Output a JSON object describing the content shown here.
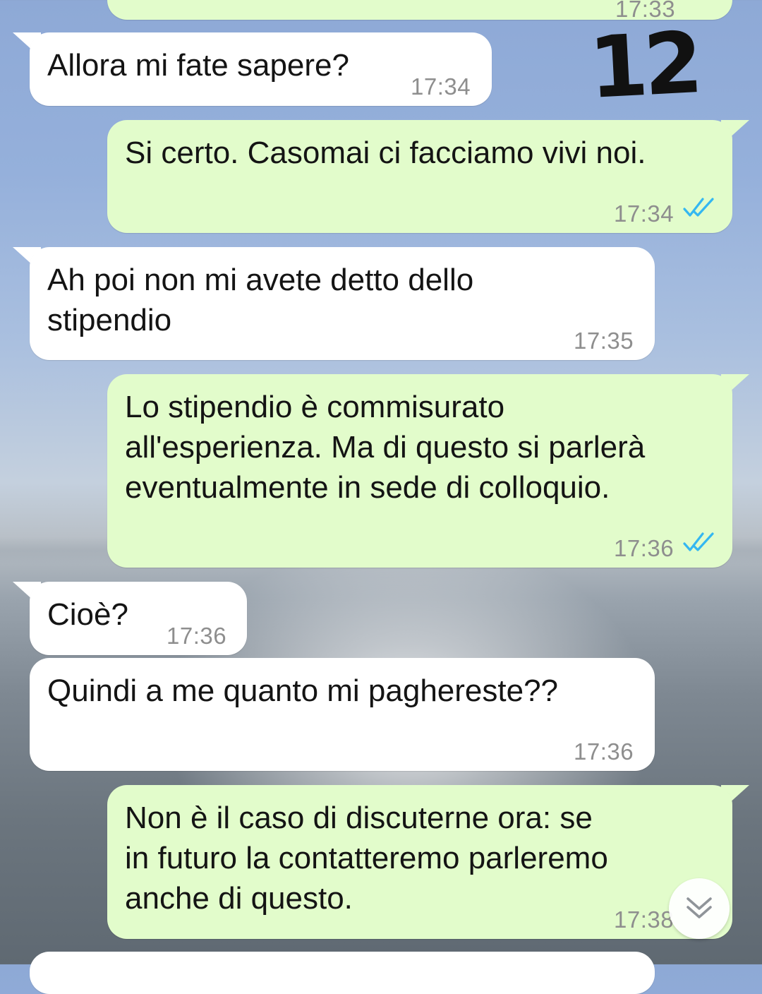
{
  "annotation": {
    "number": "12"
  },
  "messages": [
    {
      "id": "m0",
      "direction": "outgoing",
      "text": "",
      "time": "17:33",
      "read": true
    },
    {
      "id": "m1",
      "direction": "incoming",
      "text": "Allora mi fate sapere?",
      "time": "17:34"
    },
    {
      "id": "m2",
      "direction": "outgoing",
      "text": "Si certo. Casomai ci facciamo vivi noi.",
      "time": "17:34",
      "read": true
    },
    {
      "id": "m3",
      "direction": "incoming",
      "text": "Ah poi non mi avete detto dello\nstipendio",
      "time": "17:35"
    },
    {
      "id": "m4",
      "direction": "outgoing",
      "text": "Lo stipendio è commisurato\nall'esperienza. Ma di questo si parlerà\neventualmente in sede di colloquio.",
      "time": "17:36",
      "read": true
    },
    {
      "id": "m5",
      "direction": "incoming",
      "text": "Cioè?",
      "time": "17:36"
    },
    {
      "id": "m6",
      "direction": "incoming",
      "text": "Quindi a me quanto mi paghereste??",
      "time": "17:36"
    },
    {
      "id": "m7",
      "direction": "outgoing",
      "text": "Non è il caso di discuterne ora: se\nin futuro la contatteremo parleremo\nanche di questo.",
      "time": "17:38",
      "read": true
    }
  ],
  "icons": {
    "read_receipt": "double-check-icon",
    "scroll_down": "chevron-double-down-icon"
  },
  "colors": {
    "incoming_bubble": "#ffffff",
    "outgoing_bubble": "#e2fccb",
    "read_tick": "#34b7f1",
    "timestamp": "#8e8e8e"
  }
}
